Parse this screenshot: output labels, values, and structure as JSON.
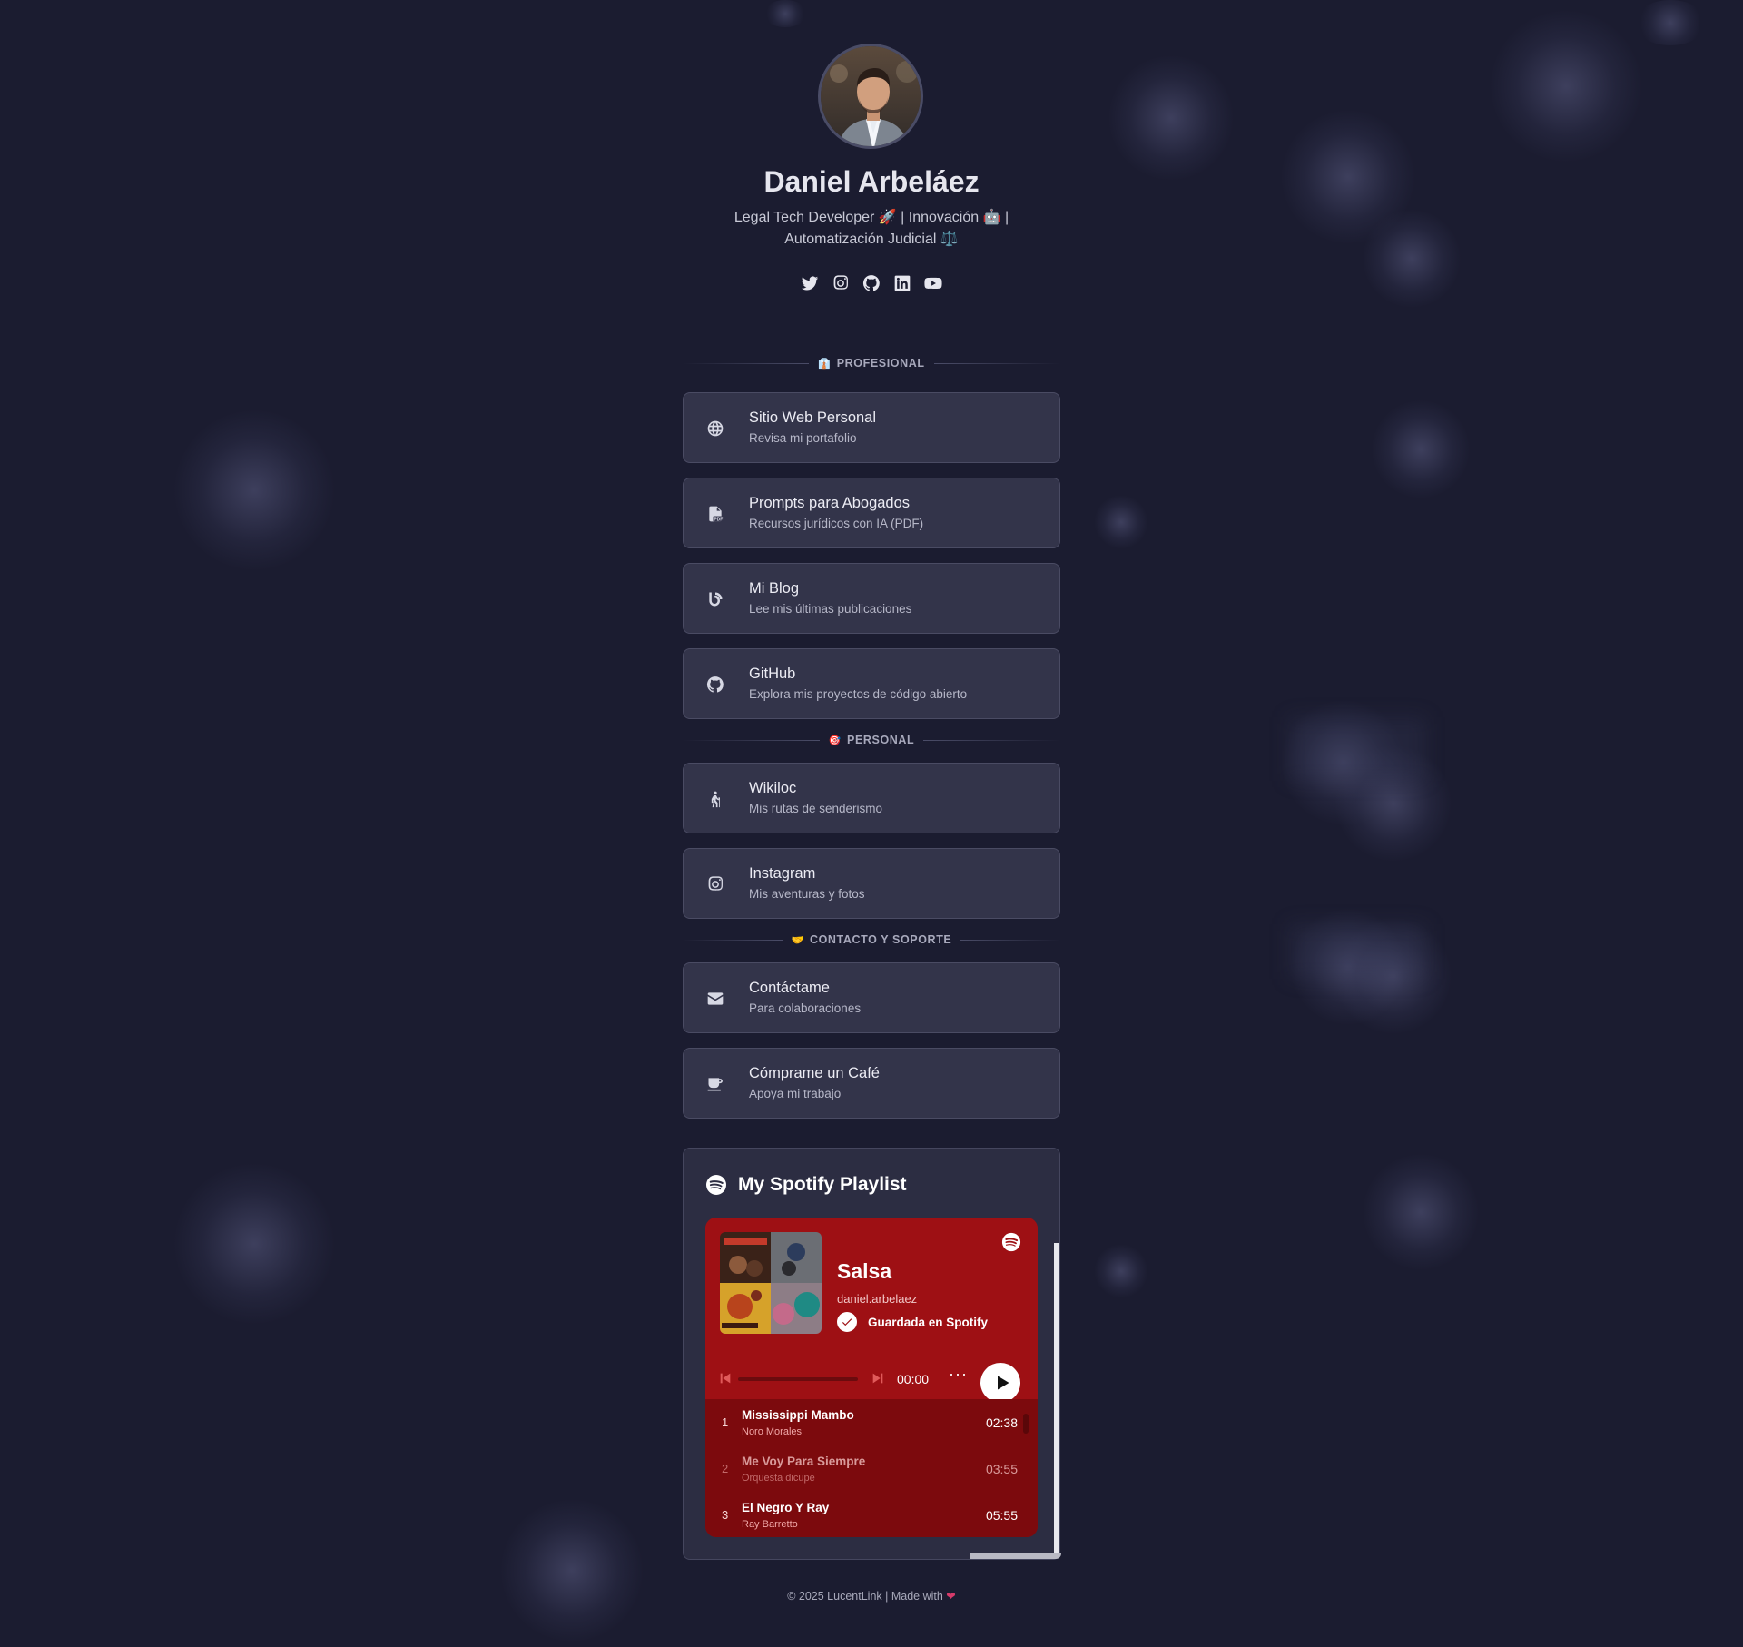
{
  "profile": {
    "name": "Daniel Arbeláez",
    "bio_line1": "Legal Tech Developer 🚀 | Innovación 🤖 |",
    "bio_line2": "Automatización Judicial ⚖️"
  },
  "social_icons": [
    "twitter-icon",
    "instagram-icon",
    "github-icon",
    "linkedin-icon",
    "youtube-icon"
  ],
  "sections": {
    "profesional": {
      "emoji": "👔",
      "title": "PROFESIONAL"
    },
    "personal": {
      "emoji": "🎯",
      "title": "PERSONAL"
    },
    "contacto": {
      "emoji": "🤝",
      "title": "CONTACTO Y SOPORTE"
    }
  },
  "links": [
    {
      "icon": "globe-icon",
      "title": "Sitio Web Personal",
      "subtitle": "Revisa mi portafolio"
    },
    {
      "icon": "pdf-file-icon",
      "title": "Prompts para Abogados",
      "subtitle": "Recursos jurídicos con IA (PDF)"
    },
    {
      "icon": "blog-icon",
      "title": "Mi Blog",
      "subtitle": "Lee mis últimas publicaciones"
    },
    {
      "icon": "github-icon",
      "title": "GitHub",
      "subtitle": "Explora mis proyectos de código abierto"
    },
    {
      "icon": "hiking-icon",
      "title": "Wikiloc",
      "subtitle": "Mis rutas de senderismo"
    },
    {
      "icon": "instagram-icon",
      "title": "Instagram",
      "subtitle": "Mis aventuras y fotos"
    },
    {
      "icon": "envelope-icon",
      "title": "Contáctame",
      "subtitle": "Para colaboraciones"
    },
    {
      "icon": "coffee-icon",
      "title": "Cómprame un Café",
      "subtitle": "Apoya mi trabajo"
    }
  ],
  "spotify": {
    "heading": "My Spotify Playlist",
    "playlist_title": "Salsa",
    "user": "daniel.arbelaez",
    "saved_label": "Guardada en Spotify",
    "time": "00:00",
    "more": "···",
    "tracks": [
      {
        "num": "1",
        "title": "Mississippi Mambo",
        "artist": "Noro Morales",
        "duration": "02:38"
      },
      {
        "num": "2",
        "title": "Me Voy Para Siempre",
        "artist": "Orquesta dicupe",
        "duration": "03:55"
      },
      {
        "num": "3",
        "title": "El Negro Y Ray",
        "artist": "Ray Barretto",
        "duration": "05:55"
      }
    ],
    "accent_color": "#9e1014"
  },
  "footer": {
    "text": "© 2025 LucentLink | Made with",
    "heart": "❤"
  }
}
